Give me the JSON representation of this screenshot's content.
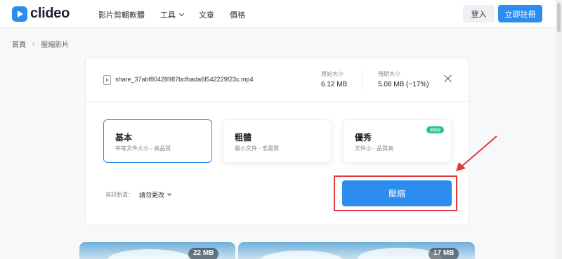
{
  "header": {
    "logo_text": "clideo",
    "nav": [
      {
        "label": "影片剪輯軟體"
      },
      {
        "label": "工具"
      },
      {
        "label": "文章"
      },
      {
        "label": "價格"
      }
    ],
    "login_label": "登入",
    "signup_label": "立即註冊"
  },
  "breadcrumb": {
    "home": "首頁",
    "current": "壓縮影片"
  },
  "file": {
    "name": "share_37abf80428987bcfbada6f542229f23c.mp4",
    "original_label": "原始大小",
    "original_value": "6.12 MB",
    "estimated_label": "預期大小",
    "estimated_value": "5.08 MB (−17%)"
  },
  "options": [
    {
      "title": "基本",
      "subtitle": "中等文件大小 - 高品質",
      "selected": true
    },
    {
      "title": "粗體",
      "subtitle": "最小文件 - 低畫質",
      "selected": false
    },
    {
      "title": "優秀",
      "subtitle": "文件小 - 品質高",
      "selected": false,
      "badge": "推薦版"
    }
  ],
  "setting": {
    "label": "音訊軌道：",
    "value": "請勿更改"
  },
  "compress_label": "壓縮",
  "thumbnails": [
    {
      "size": "22 MB"
    },
    {
      "size": "17 MB"
    }
  ],
  "colors": {
    "accent": "#2d8cf0",
    "highlight": "#e23b3b",
    "badge": "#28c28b"
  }
}
